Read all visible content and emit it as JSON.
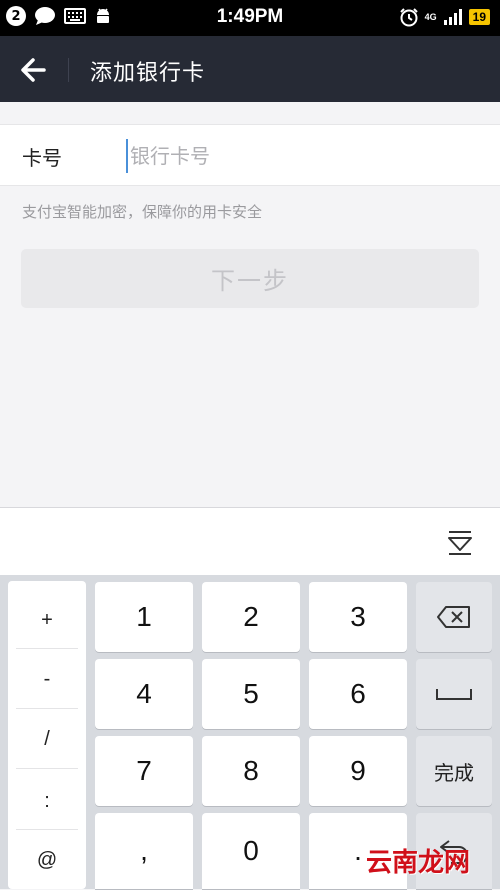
{
  "statusbar": {
    "notification_count": "2",
    "time": "1:49PM",
    "network": "4G",
    "battery": "19",
    "icons": [
      "chat-icon",
      "keyboard-icon",
      "android-icon",
      "alarm-icon",
      "signal-icon"
    ]
  },
  "header": {
    "title": "添加银行卡",
    "back_icon": "arrow-left-icon"
  },
  "form": {
    "card_label": "卡号",
    "card_placeholder": "银行卡号",
    "card_value": "",
    "hint": "支付宝智能加密，保障你的用卡安全",
    "next_label": "下一步"
  },
  "keyboard": {
    "collapse_icon": "keyboard-collapse-icon",
    "symbols": [
      "+",
      "-",
      "/",
      ":",
      "@"
    ],
    "digits": [
      "1",
      "2",
      "3",
      "4",
      "5",
      "6",
      "7",
      "8",
      "9",
      ",",
      "0",
      "."
    ],
    "backspace_icon": "backspace-icon",
    "space_icon": "space-icon",
    "done_label": "完成",
    "return_icon": "return-icon"
  },
  "watermark": "云南龙网",
  "colors": {
    "header_bg": "#262a35",
    "keyboard_bg": "#d7dadf",
    "cursor": "#4a90d9"
  }
}
